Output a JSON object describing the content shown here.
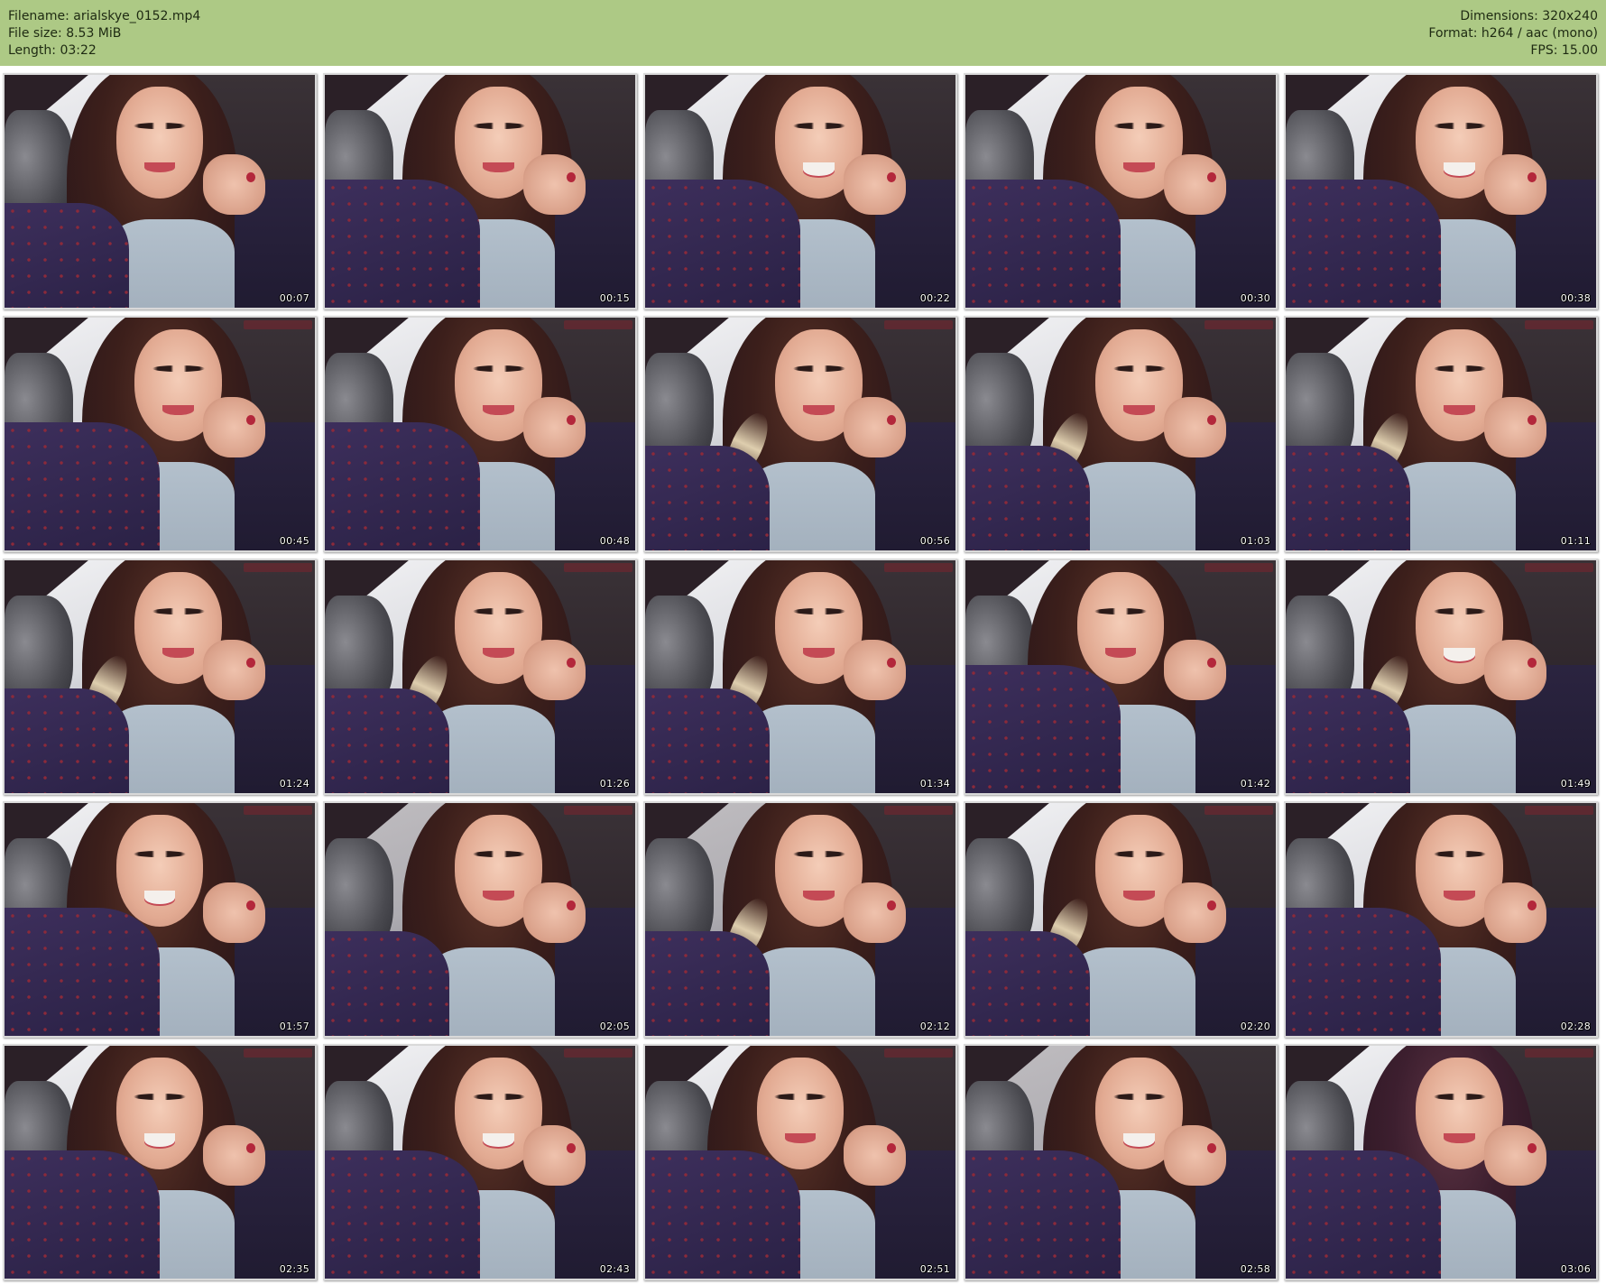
{
  "header": {
    "filename": "Filename: arialskye_0152.mp4",
    "file_size": "File size: 8.53 MiB",
    "length": "Length: 03:22",
    "dimensions": "Dimensions: 320x240",
    "format": "Format: h264 / aac (mono)",
    "fps": "FPS: 15.00"
  },
  "colors": {
    "header_bg": "#adc985",
    "thumb_border": "#d9d9d9",
    "timestamp_text": "#ffffff"
  },
  "thumbnails": [
    {
      "time": "00:07"
    },
    {
      "time": "00:15"
    },
    {
      "time": "00:22"
    },
    {
      "time": "00:30"
    },
    {
      "time": "00:38"
    },
    {
      "time": "00:45"
    },
    {
      "time": "00:48"
    },
    {
      "time": "00:56"
    },
    {
      "time": "01:03"
    },
    {
      "time": "01:11"
    },
    {
      "time": "01:24"
    },
    {
      "time": "01:26"
    },
    {
      "time": "01:34"
    },
    {
      "time": "01:42"
    },
    {
      "time": "01:49"
    },
    {
      "time": "01:57"
    },
    {
      "time": "02:05"
    },
    {
      "time": "02:12"
    },
    {
      "time": "02:20"
    },
    {
      "time": "02:28"
    },
    {
      "time": "02:35"
    },
    {
      "time": "02:43"
    },
    {
      "time": "02:51"
    },
    {
      "time": "02:58"
    },
    {
      "time": "03:06"
    }
  ]
}
